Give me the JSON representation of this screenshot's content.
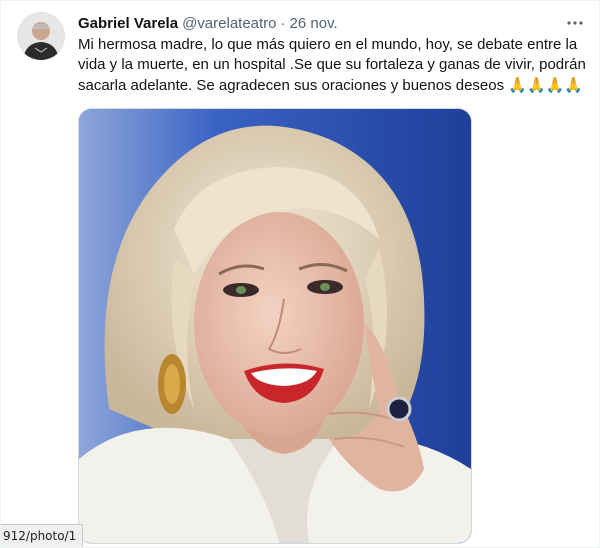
{
  "tweet": {
    "author_name": "Gabriel Varela",
    "author_handle": "@varelateatro",
    "separator": "·",
    "date": "26 nov.",
    "text": "Mi hermosa madre, lo que más quiero en el mundo, hoy, se debate entre la vida y la muerte, en un hospital .Se que su fortaleza y ganas de vivir, podrán sacarla adelante. Se agradecen sus oraciones y buenos deseos",
    "emojis": "🙏🙏🙏🙏",
    "more_icon": "more-horizontal-icon"
  },
  "status_bar": {
    "url": "912/photo/1"
  },
  "colors": {
    "text_primary": "#0f1419",
    "text_secondary": "#536471",
    "photo_background": "#2d56b8"
  }
}
